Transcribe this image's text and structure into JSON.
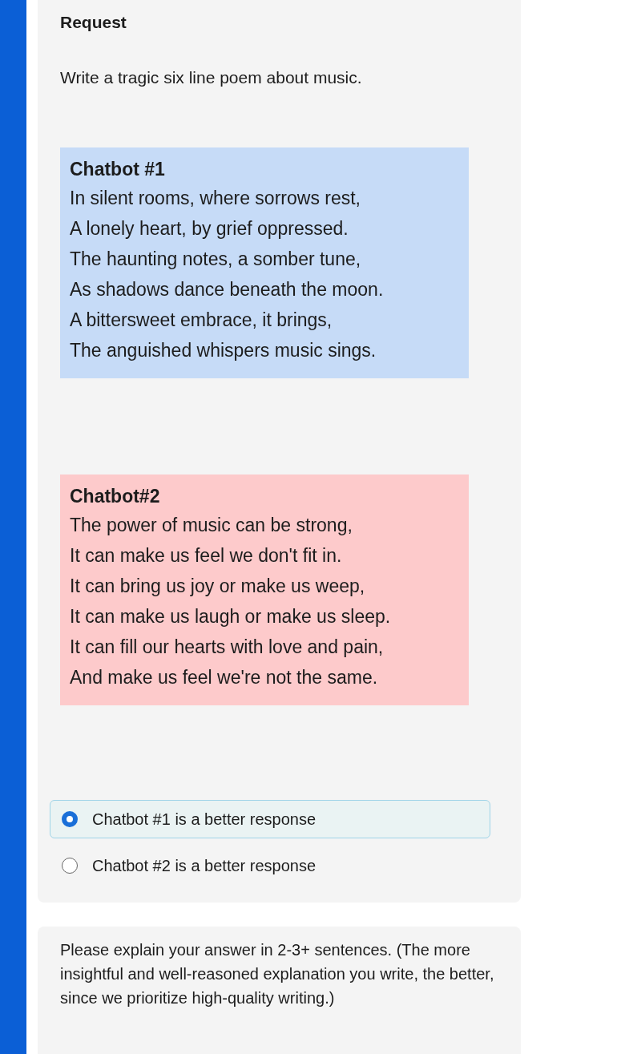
{
  "request": {
    "heading": "Request",
    "prompt": "Write a tragic six line poem about music."
  },
  "responses": [
    {
      "title": "Chatbot #1",
      "color": "#c6dbf7",
      "lines": [
        "In silent rooms, where sorrows rest,",
        "A lonely heart, by grief oppressed.",
        "The haunting notes, a somber tune,",
        "As shadows dance beneath the moon.",
        "A bittersweet embrace, it brings,",
        "The anguished whispers music sings."
      ]
    },
    {
      "title": "Chatbot#2",
      "color": "#fdcacb",
      "lines": [
        "The power of music can be strong,",
        "It can make us feel we don't fit in.",
        "It can bring us joy or make us weep,",
        "It can make us laugh or make us sleep.",
        "It can fill our hearts with love and pain,",
        "And make us feel we're not the same."
      ]
    }
  ],
  "options": [
    {
      "label": "Chatbot #1 is a better response",
      "selected": true
    },
    {
      "label": "Chatbot #2 is a better response",
      "selected": false
    }
  ],
  "explanation": {
    "instruction": "Please explain your answer in 2-3+ sentences. (The more insightful and well-reasoned explanation you write, the better, since we prioritize high-quality writing.)"
  }
}
